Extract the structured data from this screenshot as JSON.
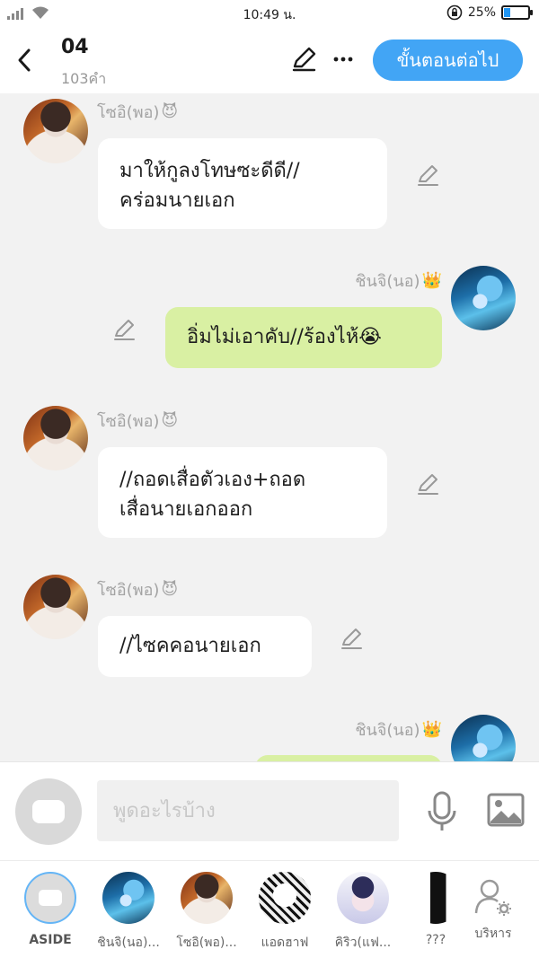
{
  "status_bar": {
    "time": "10:49 น.",
    "battery_percent": "25%",
    "battery_level": 0.25
  },
  "header": {
    "title": "04",
    "word_count": "103คำ",
    "next_button": "ขั้นตอนต่อไป",
    "icons": [
      "back-icon",
      "edit-icon",
      "more-icon"
    ]
  },
  "messages": [
    {
      "side": "left",
      "sender": "โซอิ(พอ)",
      "emoji": "😈",
      "text_line1": "มาให้กูลงโทษซะดีดี//",
      "text_line2": "คร่อมนายเอก"
    },
    {
      "side": "right",
      "sender": "ชินจิ(นอ)",
      "emoji": "👑",
      "text_line1": "อิ่มไม่เอาคับ//ร้องไห้😭"
    },
    {
      "side": "left",
      "sender": "โซอิ(พอ)",
      "emoji": "😈",
      "text_line1": "//ถอดเสื่อตัวเอง+ถอด",
      "text_line2": "เสื่อนายเอกออก"
    },
    {
      "side": "left",
      "sender": "โซอิ(พอ)",
      "emoji": "😈",
      "text_line1": "//ไซคคอนายเอก"
    },
    {
      "side": "right",
      "sender": "ชินจิ(นอ)",
      "emoji": "👑"
    }
  ],
  "input": {
    "placeholder": "พูดอะไรบ้าง"
  },
  "characters": [
    {
      "label": "ASIDE"
    },
    {
      "label": "ชินจิ(นอ)..."
    },
    {
      "label": "โซอิ(พอ)..."
    },
    {
      "label": "แอดฮาฟ"
    },
    {
      "label": "คิริว(แฟ..."
    },
    {
      "label": "???"
    },
    {
      "label": "บริหาร"
    }
  ],
  "colors": {
    "accent_blue": "#42a5f5",
    "bubble_green": "#d9f0a3",
    "bubble_white": "#ffffff",
    "background": "#f2f2f2"
  }
}
